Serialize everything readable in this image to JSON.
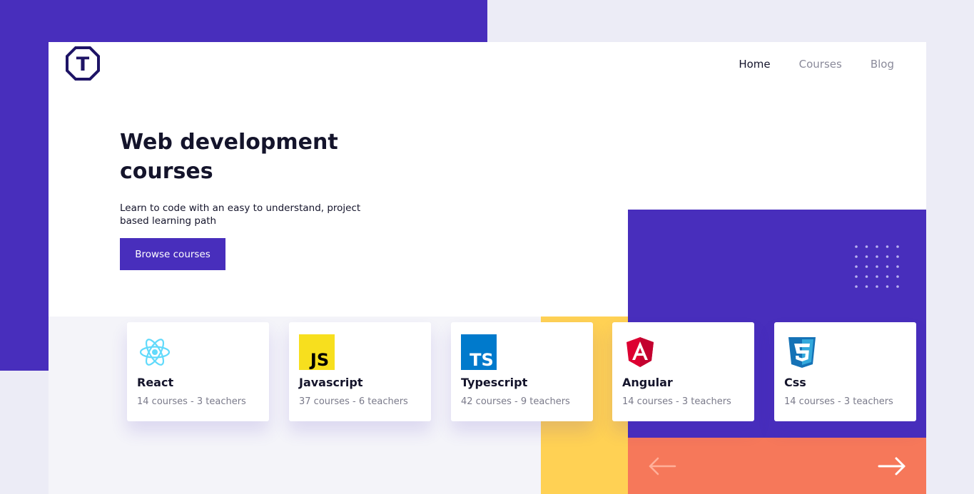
{
  "nav": {
    "items": [
      {
        "label": "Home",
        "active": true
      },
      {
        "label": "Courses",
        "active": false
      },
      {
        "label": "Blog",
        "active": false
      }
    ]
  },
  "logo": {
    "letter": "T"
  },
  "hero": {
    "title": "Web development courses",
    "subtitle": "Learn to code with an easy to understand, project based learning path",
    "cta_label": "Browse courses"
  },
  "cards": [
    {
      "title": "React",
      "meta": "14 courses - 3 teachers",
      "icon": "react-icon"
    },
    {
      "title": "Javascript",
      "meta": "37 courses - 6 teachers",
      "icon": "javascript-icon"
    },
    {
      "title": "Typescript",
      "meta": "42 courses - 9 teachers",
      "icon": "typescript-icon"
    },
    {
      "title": "Angular",
      "meta": "14 courses - 3 teachers",
      "icon": "angular-icon"
    },
    {
      "title": "Css",
      "meta": "14 courses - 3 teachers",
      "icon": "css3-icon"
    }
  ],
  "colors": {
    "primary": "#482EBC",
    "accent_yellow": "#FFD154",
    "accent_orange": "#F6785A",
    "text_dark": "#14142B",
    "background": "#ECECF6"
  }
}
